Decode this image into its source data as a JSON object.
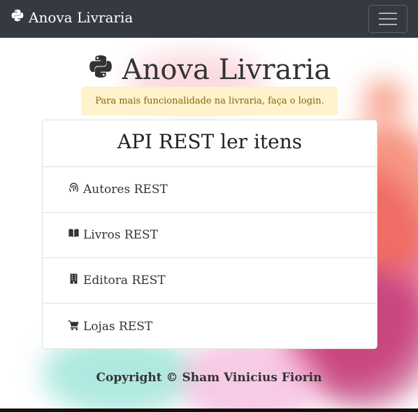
{
  "navbar": {
    "brand": "Anova Livraria",
    "brand_icon": "python-icon",
    "toggle_icon": "hamburger-icon"
  },
  "hero": {
    "title": "Anova Livraria",
    "icon": "python-icon"
  },
  "alert": {
    "text": "Para mais funcionalidade na livraria, faça o login."
  },
  "card": {
    "title": "API REST ler itens",
    "items": [
      {
        "label": "Autores REST",
        "icon": "fingerprint-icon"
      },
      {
        "label": "Livros REST",
        "icon": "book-icon"
      },
      {
        "label": "Editora REST",
        "icon": "building-icon"
      },
      {
        "label": "Lojas REST",
        "icon": "cart-icon"
      }
    ]
  },
  "footer": {
    "text": "Copyright © Sham Vinicius Fiorin"
  },
  "colors": {
    "navbar": "#343a40",
    "alert_bg": "#fff3cd",
    "alert_text": "#856404"
  }
}
